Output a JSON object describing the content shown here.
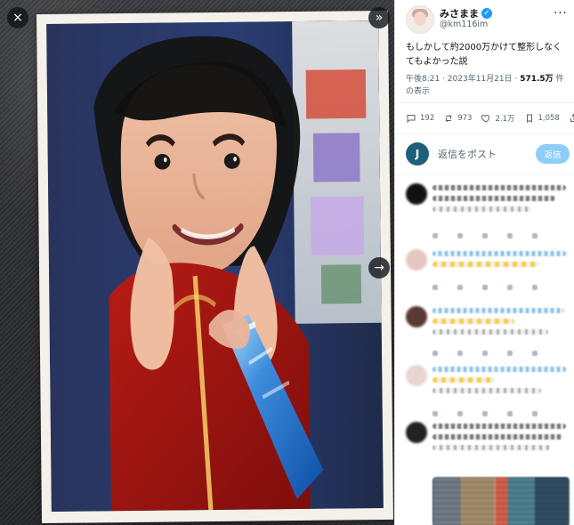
{
  "viewer": {
    "close_glyph": "×",
    "expand_glyph": "»",
    "next_glyph": "→"
  },
  "tweet": {
    "display_name": "みさまま",
    "verified_glyph": "✓",
    "handle": "@km116im",
    "more_glyph": "···",
    "text": "もしかして約2000万かけて整形しなくてもよかった説",
    "meta": {
      "time_date": "午後8:21 · 2023年11月21日 · ",
      "views_number": "571.5万",
      "views_suffix": " 件の表示"
    },
    "stats": {
      "replies": "192",
      "reposts": "973",
      "likes": "2.1万",
      "bookmarks": "1,058"
    }
  },
  "reply_composer": {
    "avatar_letter": "J",
    "prompt": "返信をポスト",
    "button_label": "返信"
  },
  "icons": {
    "reply": "reply-icon",
    "repost": "repost-icon",
    "like": "heart-icon",
    "bookmark": "bookmark-icon",
    "share": "share-icon"
  },
  "colors": {
    "accent_blue": "#1d9bf0",
    "disabled_reply_button": "#8ecdf7",
    "text_primary": "#0f1419",
    "text_secondary": "#536471"
  }
}
